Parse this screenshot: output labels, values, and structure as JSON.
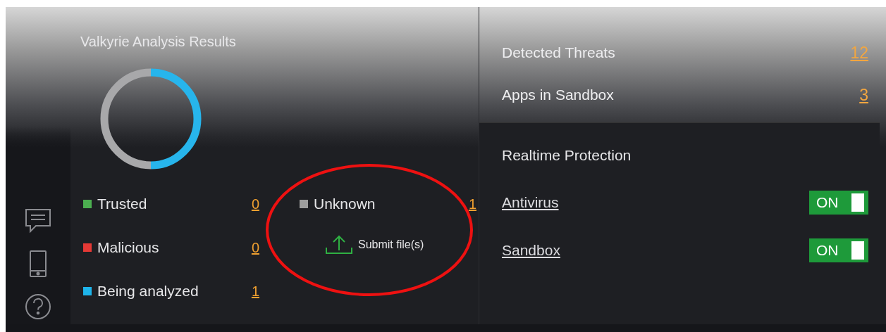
{
  "analysis": {
    "title": "Valkyrie Analysis Results",
    "legend": [
      {
        "label": "Trusted",
        "count": "0",
        "color": "#4caf50"
      },
      {
        "label": "Malicious",
        "count": "0",
        "color": "#e53935"
      },
      {
        "label": "Being analyzed",
        "count": "1",
        "color": "#1eb4ea"
      },
      {
        "label": "Unknown",
        "count": "1",
        "color": "#9e9e9e"
      }
    ],
    "submit_button": "Submit file(s)"
  },
  "summary": [
    {
      "label": "Detected Threats",
      "count": "12"
    },
    {
      "label": "Apps in Sandbox",
      "count": "3"
    }
  ],
  "realtime": {
    "title": "Realtime Protection",
    "items": [
      {
        "label": "Antivirus",
        "toggle": "ON",
        "on": true
      },
      {
        "label": "Sandbox",
        "toggle": "ON",
        "on": true
      }
    ]
  }
}
